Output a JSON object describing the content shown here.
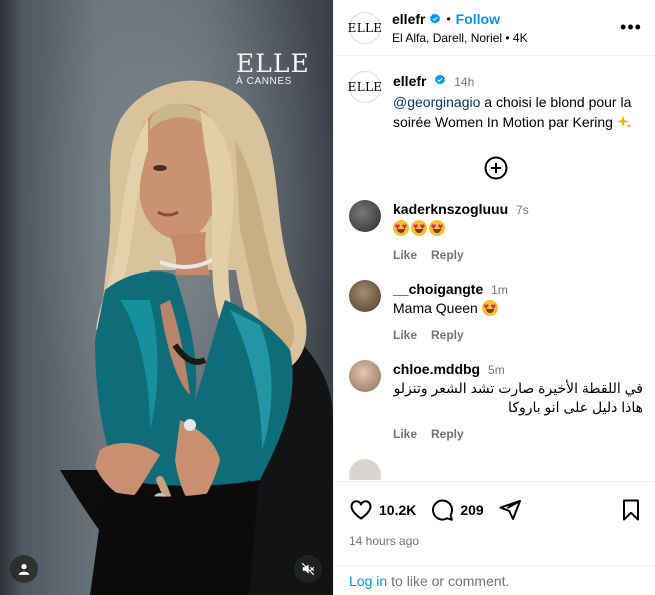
{
  "media": {
    "brand_big": "ELLE",
    "brand_small": "À CANNES"
  },
  "header": {
    "username": "ellefr",
    "follow_label": "Follow",
    "subtitle": "El Alfa, Darell, Noriel • 4K",
    "logo_text": "ELLE"
  },
  "caption": {
    "username": "ellefr",
    "time": "14h",
    "mention": "@georginagio",
    "text": " a choisi le blond pour la soirée Women In Motion par Kering "
  },
  "comments": [
    {
      "username": "kaderknszogluuu",
      "time": "7s",
      "emoji_count": 3,
      "text": "",
      "like": "Like",
      "reply": "Reply",
      "avatar_color": "#3b3b3b"
    },
    {
      "username": "__choigangte",
      "time": "1m",
      "text": "Mama Queen ",
      "emoji_count": 1,
      "like": "Like",
      "reply": "Reply",
      "avatar_color": "#6b5a49"
    },
    {
      "username": "chloe.mddbg",
      "time": "5m",
      "text": "في اللقطة الأخيرة صارت تشد الشعر وتنزلو هاذا دليل على انو باروكا",
      "emoji_count": 0,
      "like": "Like",
      "reply": "Reply",
      "avatar_color": "#c7a58c"
    }
  ],
  "footer": {
    "likes": "10.2K",
    "comments": "209",
    "ago": "14 hours ago",
    "login_link": "Log in",
    "login_text": "to like or comment."
  },
  "colors": {
    "accent": "#0095f6",
    "muted": "#737373",
    "mention": "#00376b"
  },
  "icons": [
    "verified-badge-icon",
    "more-options-icon",
    "load-more-icon",
    "heart-icon",
    "comment-icon",
    "share-icon",
    "bookmark-icon",
    "user-tag-icon",
    "mute-icon"
  ]
}
